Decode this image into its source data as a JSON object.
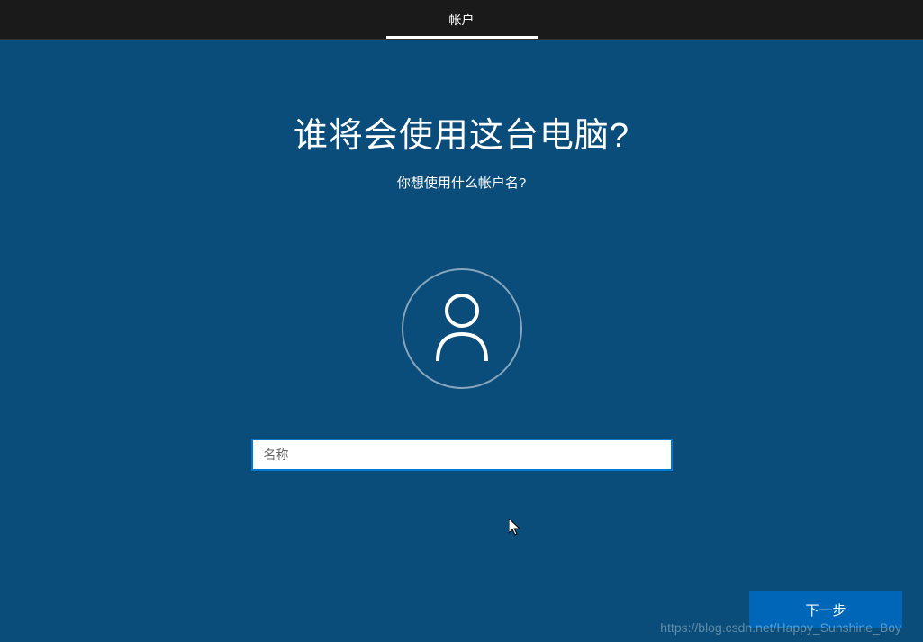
{
  "header": {
    "tab_label": "帐户"
  },
  "main": {
    "title": "谁将会使用这台电脑?",
    "subtitle": "你想使用什么帐户名?",
    "name_placeholder": "名称",
    "name_value": ""
  },
  "footer": {
    "next_button_label": "下一步"
  },
  "watermark": "https://blog.csdn.net/Happy_Sunshine_Boy"
}
